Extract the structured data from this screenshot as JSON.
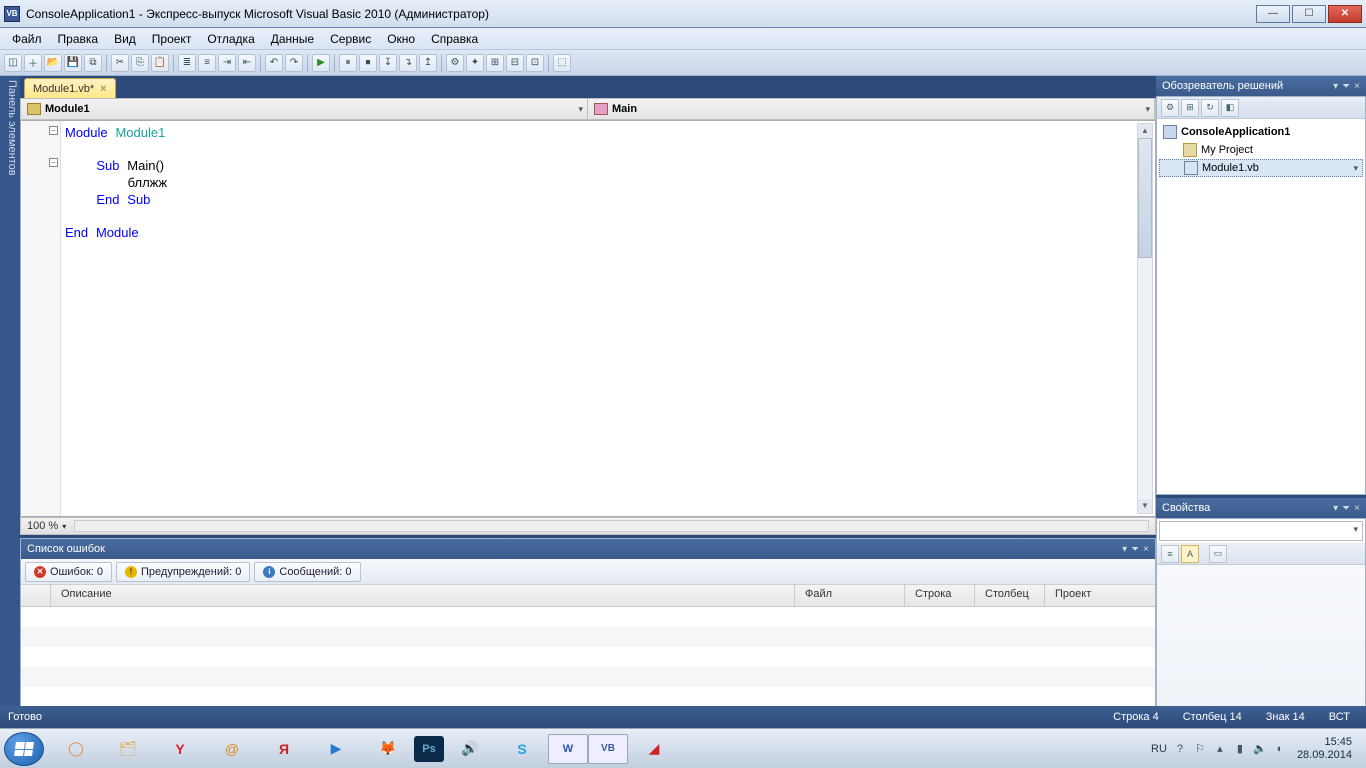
{
  "title": "ConsoleApplication1 - Экспресс-выпуск Microsoft Visual Basic 2010 (Администратор)",
  "menu": [
    "Файл",
    "Правка",
    "Вид",
    "Проект",
    "Отладка",
    "Данные",
    "Сервис",
    "Окно",
    "Справка"
  ],
  "toolbar_icons": [
    "new",
    "add",
    "open",
    "save",
    "saveall",
    "|",
    "cut",
    "copy",
    "paste",
    "|",
    "find",
    "|",
    "undo",
    "redo",
    "|",
    "play",
    "|",
    "bp",
    "stepover",
    "stepin",
    "stepout",
    "|",
    "t1",
    "t2",
    "t3",
    "t4",
    "t5",
    "t6",
    "|",
    "ext"
  ],
  "sidebar_left": "Панель элементов",
  "doc_tab": "Module1.vb*",
  "selector_class": "Module1",
  "selector_method": "Main",
  "code": {
    "l1a": "Module",
    "l1b": "Module1",
    "l2a": "Sub",
    "l2b": "Main()",
    "l3": "бллжж",
    "l4a": "End",
    "l4b": "Sub",
    "l5a": "End",
    "l5b": "Module"
  },
  "zoom": "100 %",
  "errlist": {
    "title": "Список ошибок",
    "btn_err": "Ошибок: 0",
    "btn_warn": "Предупреждений: 0",
    "btn_msg": "Сообщений: 0",
    "cols": {
      "desc": "Описание",
      "file": "Файл",
      "line": "Строка",
      "col": "Столбец",
      "proj": "Проект"
    }
  },
  "soln": {
    "title": "Обозреватель решений",
    "project": "ConsoleApplication1",
    "myproj": "My Project",
    "module": "Module1.vb"
  },
  "props": {
    "title": "Свойства"
  },
  "status": {
    "ready": "Готово",
    "line": "Строка 4",
    "col": "Столбец 14",
    "char": "Знак 14",
    "ins": "ВСТ"
  },
  "tray": {
    "lang": "RU",
    "time": "15:45",
    "date": "28.09.2014"
  }
}
